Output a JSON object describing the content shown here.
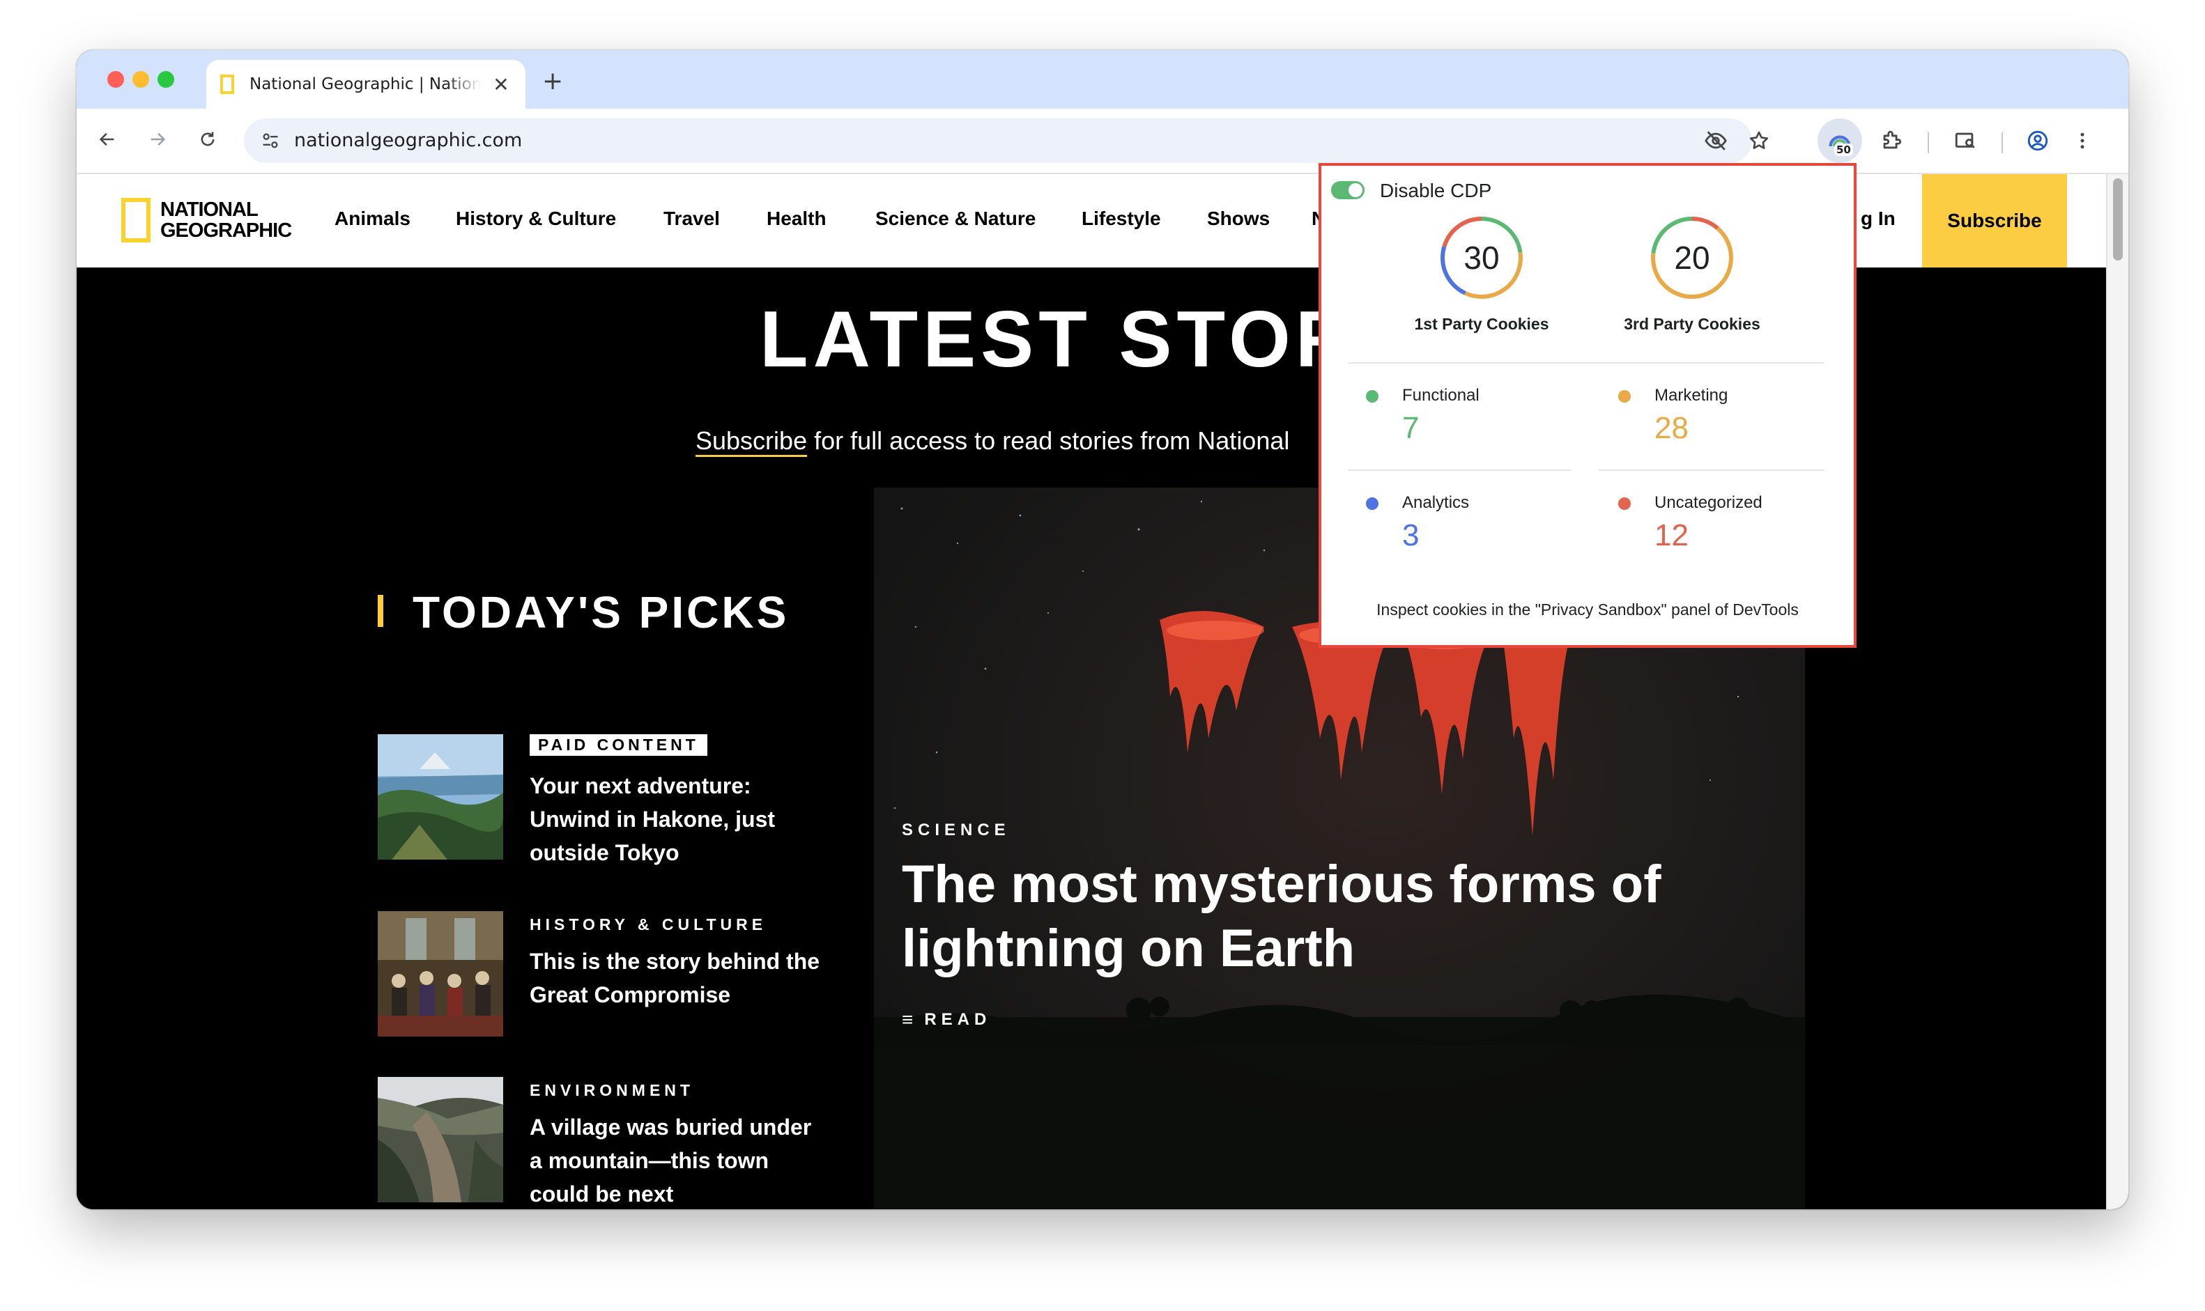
{
  "browser": {
    "tab_title": "National Geographic | National Geographic",
    "tab_close": "✕",
    "new_tab": "+",
    "url": "nationalgeographic.com",
    "extension_badge": "50"
  },
  "site": {
    "logo_line1": "NATIONAL",
    "logo_line2": "GEOGRAPHIC",
    "nav": [
      "Animals",
      "History & Culture",
      "Travel",
      "Health",
      "Science & Nature",
      "Lifestyle",
      "Shows",
      "N"
    ],
    "login_partial": "g In",
    "subscribe": "Subscribe"
  },
  "latest": {
    "title": "LATEST STORI",
    "subscribe_link": "Subscribe",
    "subtitle_rest": " for full access to read stories from National"
  },
  "picks": {
    "title": "TODAY'S PICKS",
    "items": [
      {
        "kicker": "PAID CONTENT",
        "headline": "Your next adventure: Unwind in Hakone, just outside Tokyo"
      },
      {
        "kicker": "HISTORY & CULTURE",
        "headline": "This is the story behind the Great Compromise"
      },
      {
        "kicker": "ENVIRONMENT",
        "headline": "A village was buried under a mountain—this town could be next"
      }
    ]
  },
  "hero": {
    "kicker": "SCIENCE",
    "title": "The most mysterious forms of lightning on Earth",
    "read": "READ"
  },
  "popup": {
    "toggle_label": "Disable CDP",
    "first_party": {
      "count": "30",
      "label": "1st Party Cookies"
    },
    "third_party": {
      "count": "20",
      "label": "3rd Party Cookies"
    },
    "categories": [
      {
        "name": "Functional",
        "count": "7",
        "color": "#5bb974"
      },
      {
        "name": "Marketing",
        "count": "28",
        "color": "#e9a946"
      },
      {
        "name": "Analytics",
        "count": "3",
        "color": "#4f73e0"
      },
      {
        "name": "Uncategorized",
        "count": "12",
        "color": "#e3644c"
      }
    ],
    "footer": "Inspect cookies in the \"Privacy Sandbox\" panel of DevTools"
  },
  "colors": {
    "accent_yellow": "#fccc43",
    "popup_border": "#e8473f"
  }
}
